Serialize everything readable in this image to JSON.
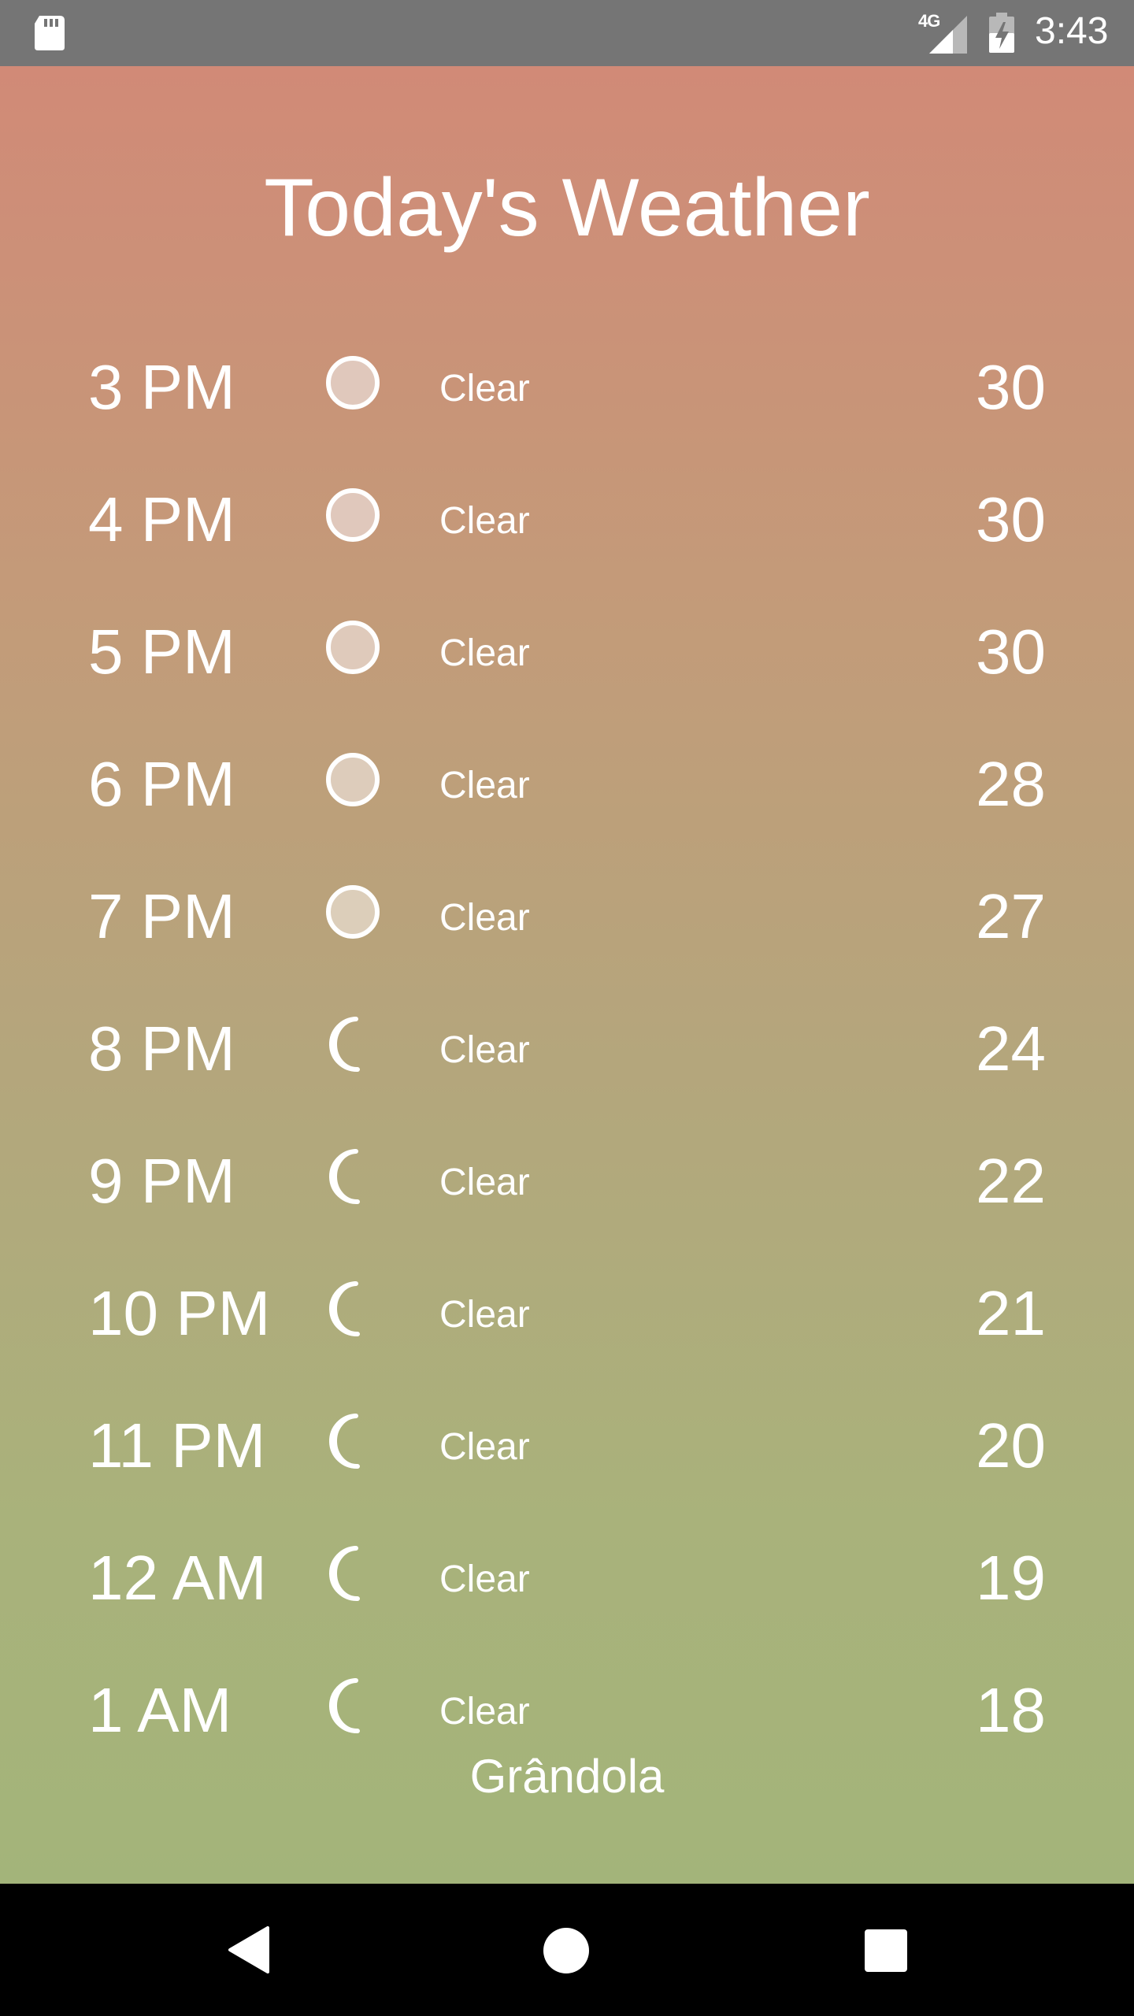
{
  "status_bar": {
    "time": "3:43",
    "network": "4G",
    "icons": [
      "sd-card-icon",
      "cell-signal-icon",
      "battery-charging-icon"
    ]
  },
  "page": {
    "title": "Today's Weather",
    "location": "Grândola"
  },
  "forecast": [
    {
      "time": "3 PM",
      "icon": "sun-icon",
      "condition": "Clear",
      "temp": "30"
    },
    {
      "time": "4 PM",
      "icon": "sun-icon",
      "condition": "Clear",
      "temp": "30"
    },
    {
      "time": "5 PM",
      "icon": "sun-icon",
      "condition": "Clear",
      "temp": "30"
    },
    {
      "time": "6 PM",
      "icon": "sun-icon",
      "condition": "Clear",
      "temp": "28"
    },
    {
      "time": "7 PM",
      "icon": "sun-icon",
      "condition": "Clear",
      "temp": "27"
    },
    {
      "time": "8 PM",
      "icon": "moon-icon",
      "condition": "Clear",
      "temp": "24"
    },
    {
      "time": "9 PM",
      "icon": "moon-icon",
      "condition": "Clear",
      "temp": "22"
    },
    {
      "time": "10 PM",
      "icon": "moon-icon",
      "condition": "Clear",
      "temp": "21"
    },
    {
      "time": "11 PM",
      "icon": "moon-icon",
      "condition": "Clear",
      "temp": "20"
    },
    {
      "time": "12 AM",
      "icon": "moon-icon",
      "condition": "Clear",
      "temp": "19"
    },
    {
      "time": "1 AM",
      "icon": "moon-icon",
      "condition": "Clear",
      "temp": "18"
    }
  ],
  "nav_bar": {
    "buttons": [
      "back-button",
      "home-button",
      "recents-button"
    ]
  },
  "colors": {
    "status_bar": "#757575",
    "gradient_top": "#d18a77",
    "gradient_bottom": "#a3b47a",
    "text": "#ffffff",
    "nav_bar": "#000000"
  }
}
